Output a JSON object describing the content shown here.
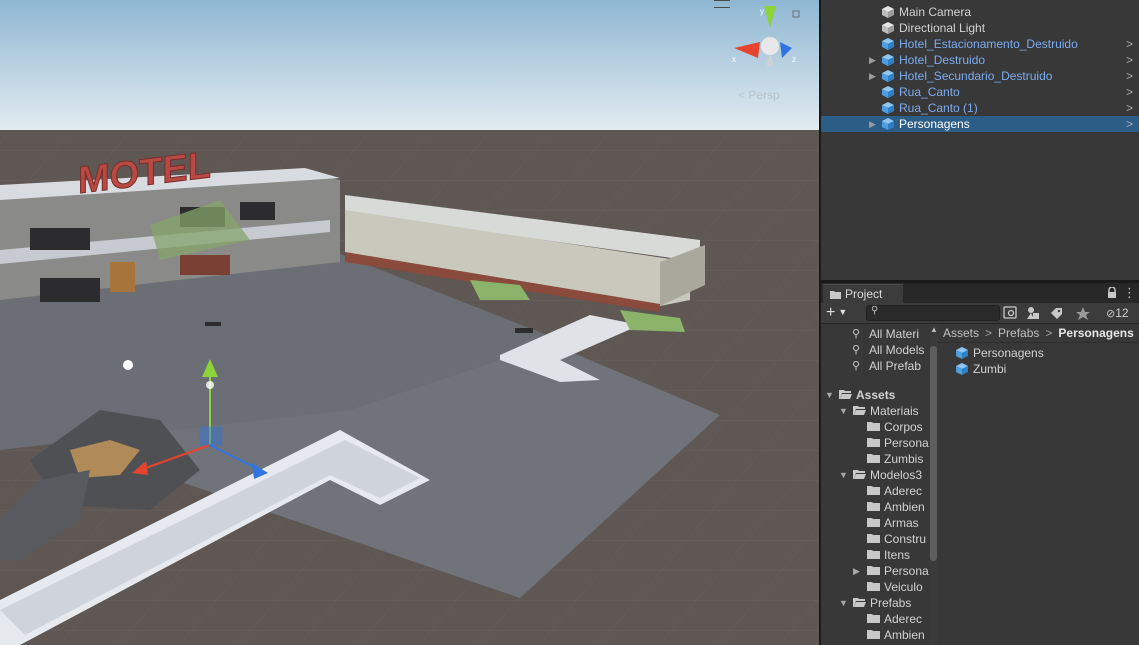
{
  "scene": {
    "perspective_label": "< Persp",
    "gizmo_axes": {
      "y": "y",
      "x": "x",
      "z": "z"
    },
    "motel_sign": "MOTEL",
    "colors": {
      "sky_top": "#8fb7d2",
      "sky_horizon": "#e3ecf1",
      "ground": "#5f5754",
      "floor": "#707275",
      "x_axis": "#e5452f",
      "y_axis": "#8dd43a",
      "z_axis": "#2f74e0"
    }
  },
  "hierarchy": {
    "items": [
      {
        "label": "Main Camera",
        "prefab": false,
        "expandable": false,
        "selected": false
      },
      {
        "label": "Directional Light",
        "prefab": false,
        "expandable": false,
        "selected": false
      },
      {
        "label": "Hotel_Estacionamento_Destruido",
        "prefab": true,
        "expandable": false,
        "selected": false
      },
      {
        "label": "Hotel_Destruido",
        "prefab": true,
        "expandable": true,
        "selected": false
      },
      {
        "label": "Hotel_Secundario_Destruido",
        "prefab": true,
        "expandable": true,
        "selected": false
      },
      {
        "label": "Rua_Canto",
        "prefab": true,
        "expandable": false,
        "selected": false
      },
      {
        "label": "Rua_Canto (1)",
        "prefab": true,
        "expandable": false,
        "selected": false
      },
      {
        "label": "Personagens",
        "prefab": true,
        "expandable": true,
        "selected": true
      }
    ],
    "chevron": ">"
  },
  "project": {
    "tab_label": "Project",
    "search_placeholder": "",
    "hidden_count": "12",
    "favorites": [
      "All Materi",
      "All Models",
      "All Prefab"
    ],
    "tree": [
      {
        "label": "Assets",
        "depth": 0,
        "expanded": true,
        "bold": true
      },
      {
        "label": "Materiais",
        "depth": 1,
        "expanded": true
      },
      {
        "label": "Corpos",
        "depth": 2
      },
      {
        "label": "Persona",
        "depth": 2
      },
      {
        "label": "Zumbis",
        "depth": 2
      },
      {
        "label": "Modelos3",
        "depth": 1,
        "expanded": true
      },
      {
        "label": "Aderec",
        "depth": 2
      },
      {
        "label": "Ambien",
        "depth": 2
      },
      {
        "label": "Armas",
        "depth": 2
      },
      {
        "label": "Constru",
        "depth": 2
      },
      {
        "label": "Itens",
        "depth": 2
      },
      {
        "label": "Persona",
        "depth": 2,
        "collapsed": true
      },
      {
        "label": "Veiculo",
        "depth": 2
      },
      {
        "label": "Prefabs",
        "depth": 1,
        "expanded": true
      },
      {
        "label": "Aderec",
        "depth": 2
      },
      {
        "label": "Ambien",
        "depth": 2
      }
    ],
    "breadcrumb": {
      "parts": [
        "Assets",
        "Prefabs",
        "Personagens"
      ],
      "separator": ">"
    },
    "assets": [
      {
        "label": "Personagens"
      },
      {
        "label": "Zumbi"
      }
    ]
  }
}
